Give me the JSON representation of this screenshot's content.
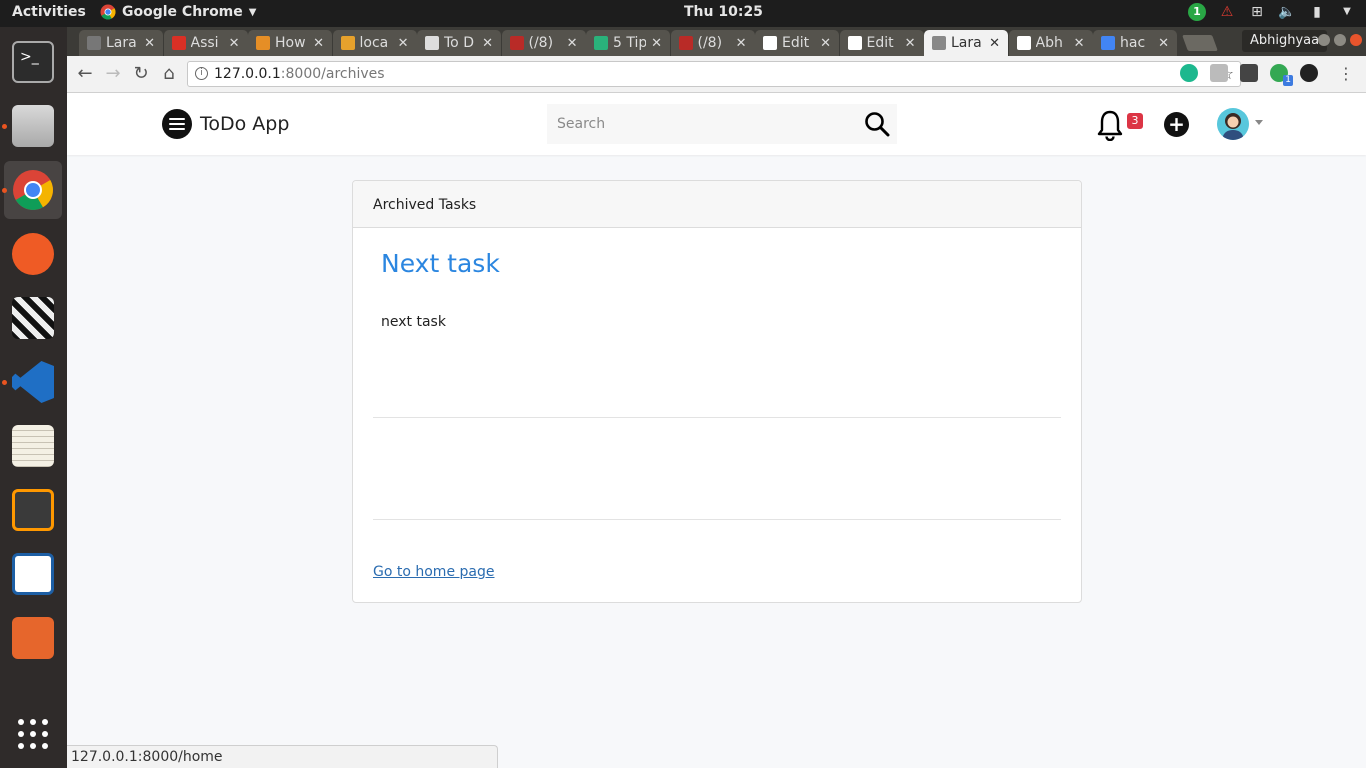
{
  "system": {
    "activities": "Activities",
    "app_menu": "Google Chrome",
    "clock": "Thu 10:25",
    "tray_badge": "1"
  },
  "browser": {
    "tabs": [
      {
        "title": "Lara",
        "color": "#777777"
      },
      {
        "title": "Assi",
        "color": "#d93025"
      },
      {
        "title": "How",
        "color": "#e58e26"
      },
      {
        "title": "loca",
        "color": "#e6a12c"
      },
      {
        "title": "To D",
        "color": "#dddddd"
      },
      {
        "title": "(/8)",
        "color": "#b92b27"
      },
      {
        "title": "5 Tip",
        "color": "#2ab27b"
      },
      {
        "title": "(/8)",
        "color": "#b92b27"
      },
      {
        "title": "Edit",
        "color": "#ffffff"
      },
      {
        "title": "Edit",
        "color": "#ffffff"
      },
      {
        "title": "Lara",
        "color": "#888888"
      },
      {
        "title": "Abh",
        "color": "#ffffff"
      },
      {
        "title": "hac",
        "color": "#4285f4"
      }
    ],
    "active_tab_index": 10,
    "profile": "Abhighyaa",
    "url_host": "127.0.0.1",
    "url_path": ":8000/archives",
    "extension_badge": "1",
    "status_url": "127.0.0.1:8000/home"
  },
  "app": {
    "brand": "ToDo App",
    "search_placeholder": "Search",
    "notification_count": "3",
    "add_label": "+",
    "card": {
      "header": "Archived Tasks",
      "task_title": "Next task",
      "task_body": "next task",
      "home_link": "Go to home page"
    },
    "colors": {
      "accent": "#2b86e0",
      "link": "#2b6cb0",
      "badge": "#dc3545"
    }
  }
}
